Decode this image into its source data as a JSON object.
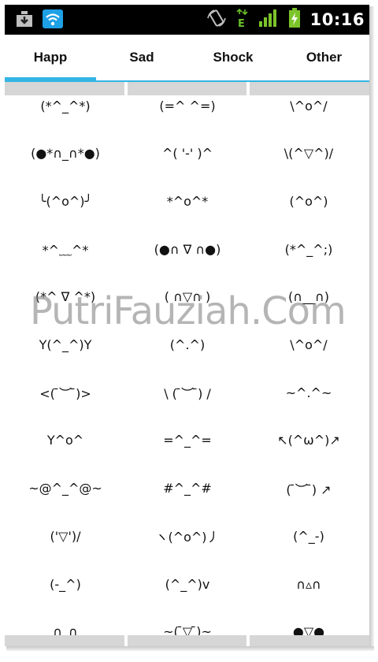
{
  "status_bar": {
    "time": "10:16",
    "left_icons": [
      "download-icon",
      "wifi-icon"
    ],
    "right_icons": [
      "rotate-icon",
      "data-e-icon",
      "signal-icon",
      "battery-charging-icon"
    ]
  },
  "tabs": [
    {
      "label": "Happ",
      "active": true
    },
    {
      "label": "Sad",
      "active": false
    },
    {
      "label": "Shock",
      "active": false
    },
    {
      "label": "Other",
      "active": false
    }
  ],
  "emoticons": [
    [
      "(*^_^*)",
      "(=^ ^=)",
      "\\^o^/"
    ],
    [
      "(●*∩_∩*●)",
      "^( '-' )^",
      "\\(^▽^)/"
    ],
    [
      "╰(^o^)╯",
      "*^o^*",
      "(^o^)"
    ],
    [
      "*^﹏^*",
      "(●∩ ∇ ∩●)",
      "(*^_^;)"
    ],
    [
      "(*^ ∇ ^*)",
      "( ∩▽∩ )",
      "(∩__∩)"
    ],
    [
      "Y(^_^)Y",
      "(^.^)",
      "\\^o^/"
    ],
    [
      "<( ̄︶ ̄)>",
      "\\ ( ̄︶ ̄) /",
      "~^.^~"
    ],
    [
      "Y^o^",
      "=^_^=",
      "↖(^ω^)↗"
    ],
    [
      "~@^_^@~",
      "#^_^#",
      "( ̄︶ ̄) ↗"
    ],
    [
      "('▽')/",
      "ヽ(^o^)丿",
      "(^_-)"
    ],
    [
      "(-_^)",
      "(^_^)v",
      "∩▵∩"
    ],
    [
      "∩_∩",
      "~( ̄▽ ̄)~",
      "●▽●"
    ]
  ],
  "watermark": "PutriFauziah.Com",
  "colors": {
    "accent": "#33b5e5",
    "status_bar": "#000000",
    "header_strip": "#d6d6d6"
  }
}
